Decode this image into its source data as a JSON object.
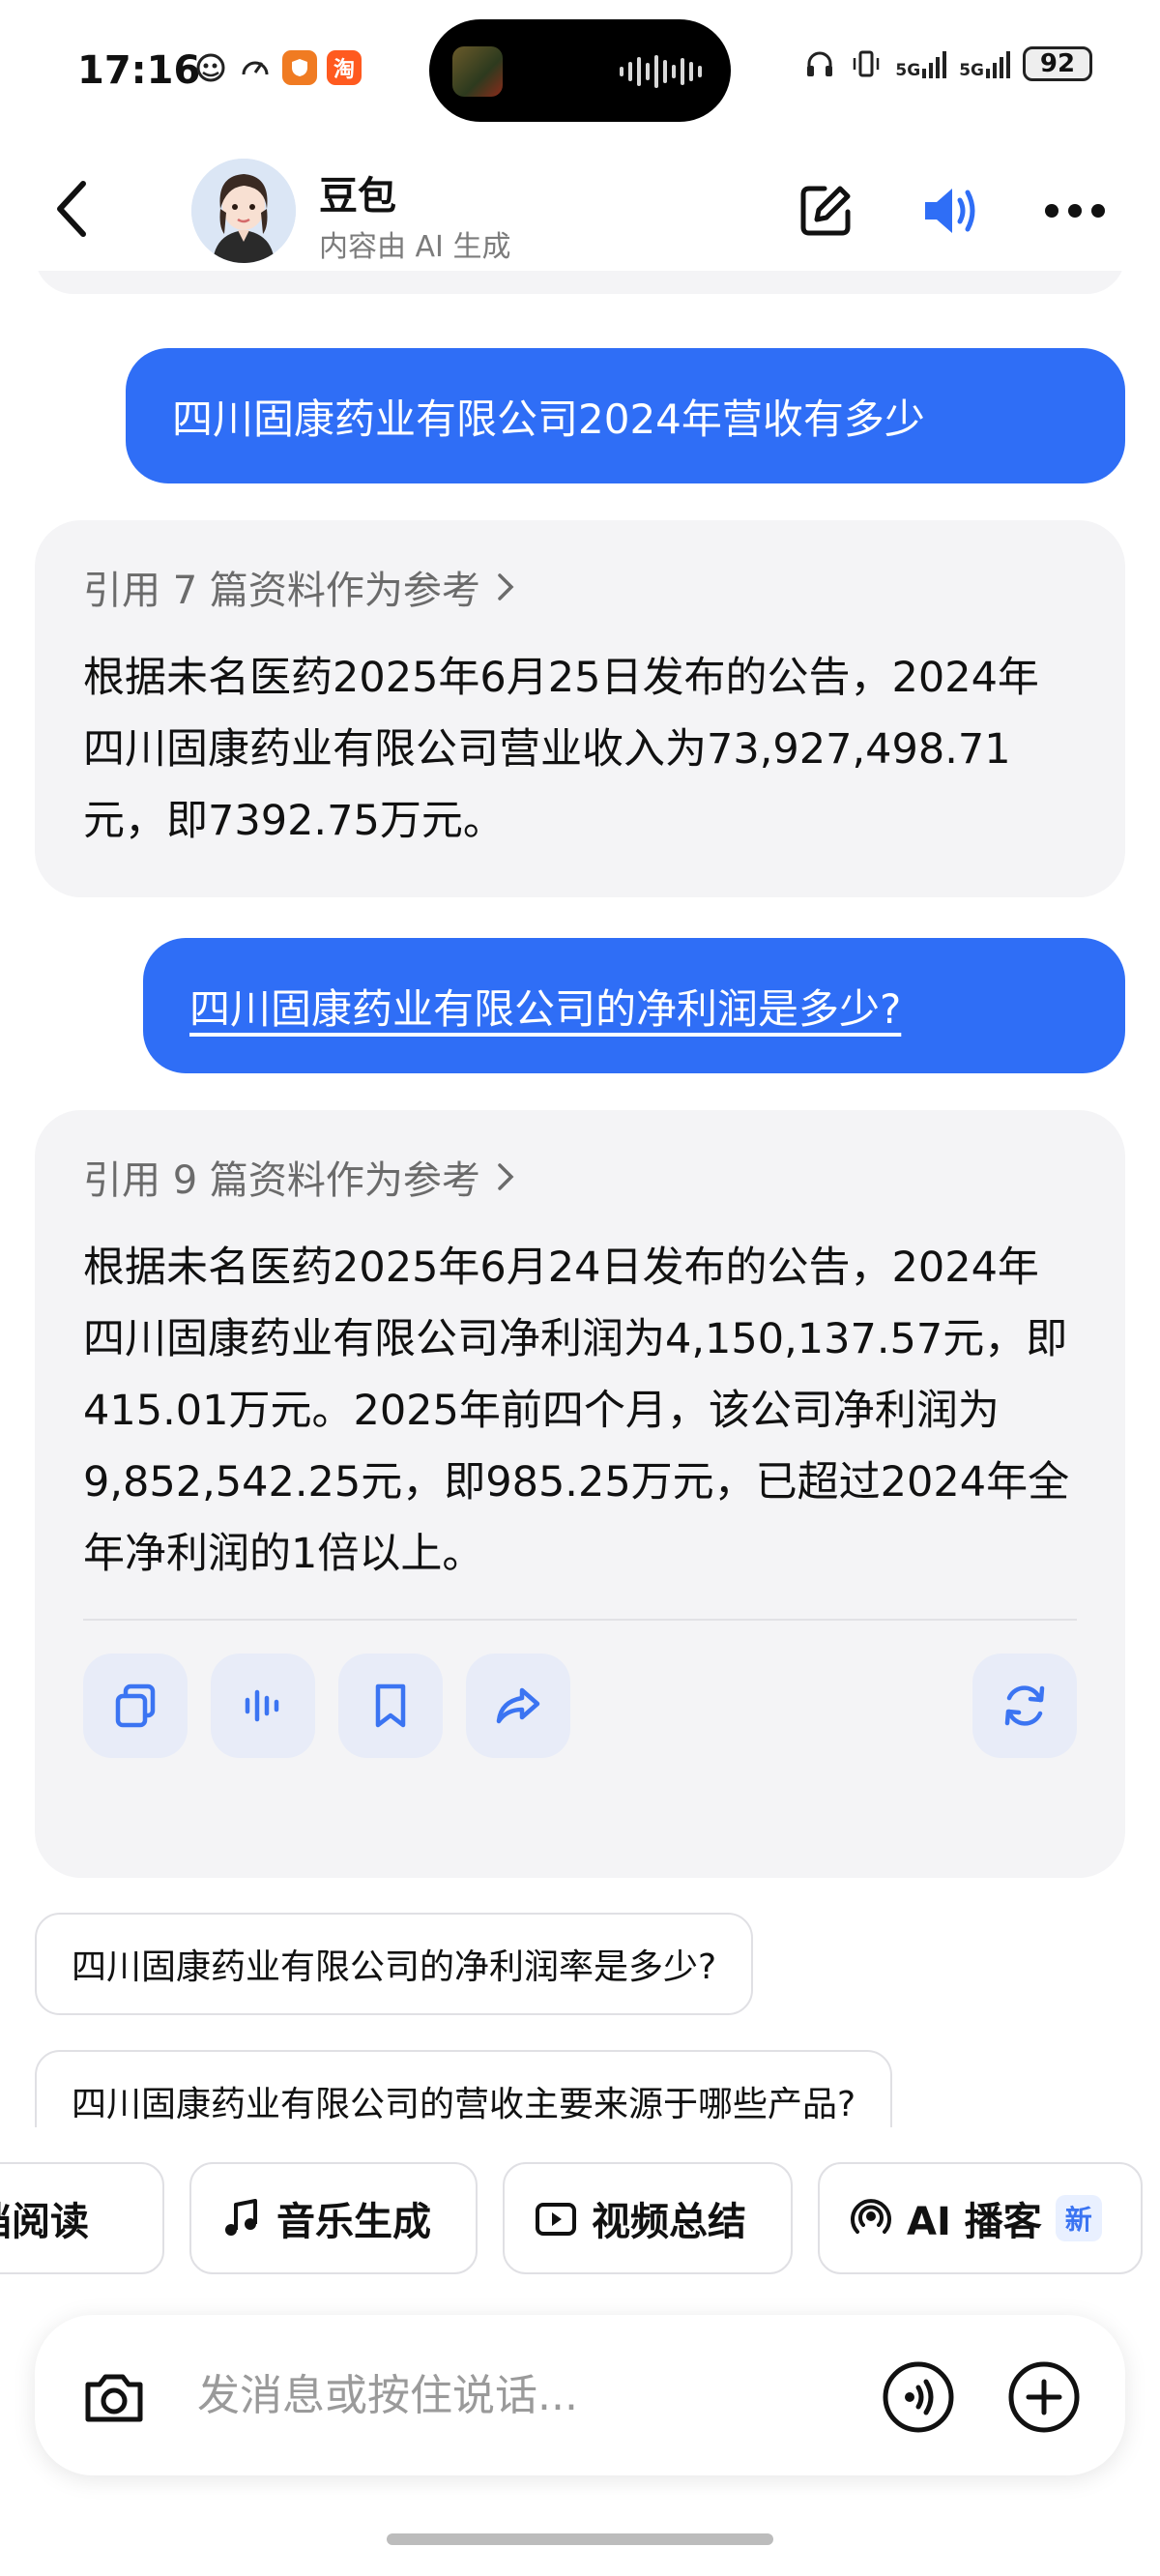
{
  "status_bar": {
    "time": "17:16",
    "app_badges": [
      "淘"
    ],
    "network": [
      "5G",
      "5G"
    ],
    "battery": "92"
  },
  "header": {
    "title": "豆包",
    "subtitle": "内容由 AI 生成"
  },
  "conversation": {
    "q1": "四川固康药业有限公司2024年营收有多少",
    "a1": {
      "reference": "引用 7 篇资料作为参考",
      "text": "根据未名医药2025年6月25日发布的公告，2024年四川固康药业有限公司营业收入为73,927,498.71元，即7392.75万元。"
    },
    "q2": "四川固康药业有限公司的净利润是多少?",
    "a2": {
      "reference": "引用 9 篇资料作为参考",
      "text": "根据未名医药2025年6月24日发布的公告，2024年四川固康药业有限公司净利润为4,150,137.57元，即415.01万元。2025年前四个月，该公司净利润为9,852,542.25元，即985.25万元，已超过2024年全年净利润的1倍以上。"
    }
  },
  "suggestions": [
    "四川固康药业有限公司的净利润率是多少?",
    "四川固康药业有限公司的营收主要来源于哪些产品?"
  ],
  "tools": [
    {
      "label": "文档阅读",
      "icon": "document-icon"
    },
    {
      "label": "音乐生成",
      "icon": "music-note-icon"
    },
    {
      "label": "视频总结",
      "icon": "video-icon"
    },
    {
      "label": "AI 播客",
      "icon": "podcast-icon",
      "badge": "新"
    }
  ],
  "input": {
    "placeholder": "发消息或按住说话..."
  },
  "colors": {
    "accent": "#2f6ef6",
    "card_bg": "#f4f4f6",
    "icon_blue": "#3b74f2"
  }
}
